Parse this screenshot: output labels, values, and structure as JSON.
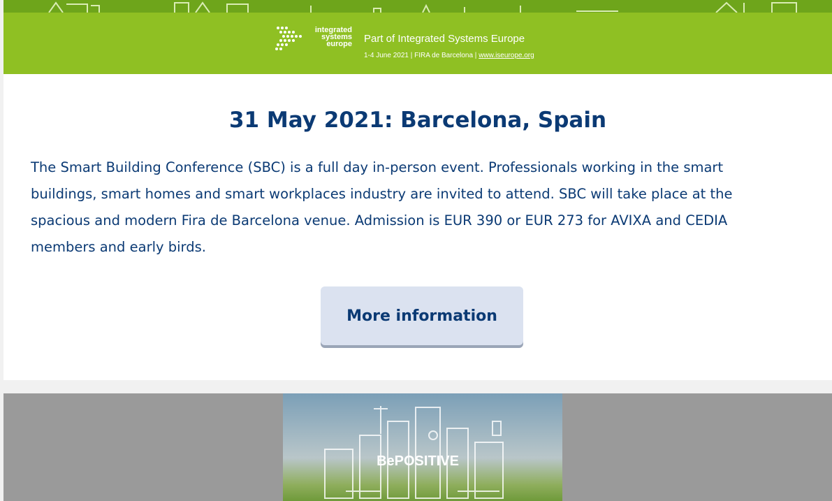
{
  "banner": {
    "logo_lines": [
      "integrated",
      "systems",
      "europe"
    ],
    "title": "Part of Integrated Systems Europe",
    "subtitle": "1-4 June 2021 | FIRA de Barcelona | ",
    "link": "www.iseurope.org"
  },
  "event": {
    "heading": "31 May 2021: Barcelona, Spain",
    "description": "The Smart Building Conference (SBC) is a full day in-person event. Professionals working in the smart buildings, smart homes and smart workplaces industry are invited to attend. SBC will take place at the spacious and modern Fira de Barcelona venue. Admission is EUR 390 or EUR  273 for AVIXA and CEDIA members and early birds.",
    "button_label": "More information"
  },
  "hero": {
    "label": "BePOSITIVE"
  },
  "colors": {
    "banner_green": "#8fc023",
    "text_navy": "#0b3a74",
    "button_bg": "#dbe2f0"
  }
}
